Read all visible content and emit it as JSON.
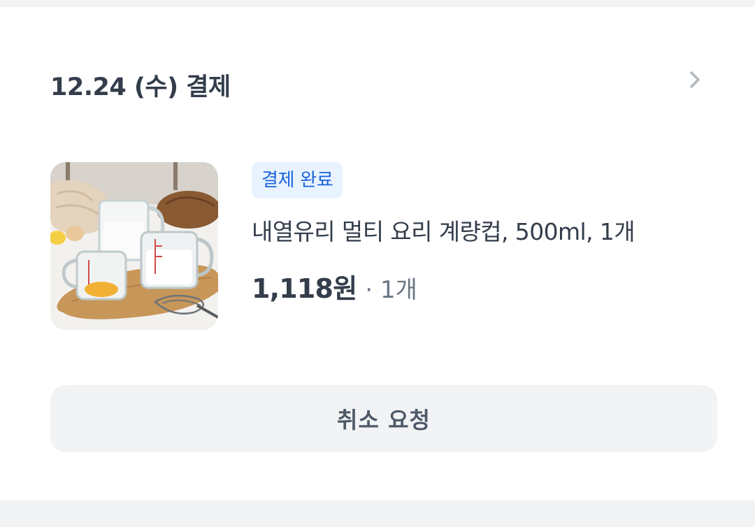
{
  "order": {
    "date_title": "12.24 (수) 결제",
    "status_badge": "결제 완료",
    "product_name": "내열유리 멀티 요리 계량컵, 500ml, 1개",
    "price": "1,118원",
    "quantity": "· 1개",
    "cancel_button_label": "취소 요청",
    "detail_icon": "chevron-right-icon",
    "product_image": "measuring-cups-photo"
  },
  "colors": {
    "page_background": "#f2f3f5",
    "card_background": "#ffffff",
    "primary_text": "#333d4b",
    "secondary_text": "#6b7684",
    "badge_background": "#e8f3ff",
    "badge_text": "#1b64da",
    "button_background": "#f2f3f5",
    "button_text": "#4e5968",
    "chevron": "#b0b8c1"
  }
}
